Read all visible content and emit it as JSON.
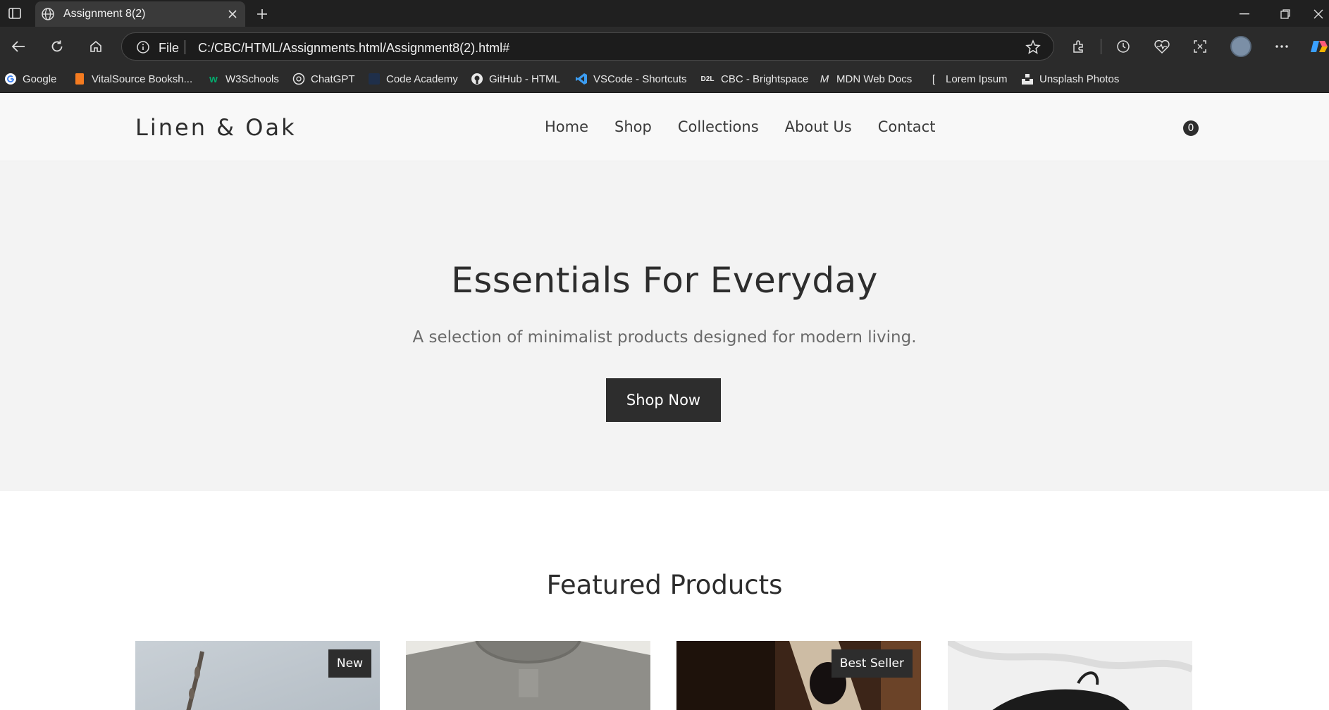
{
  "browser": {
    "tab_title": "Assignment 8(2)",
    "scheme_label": "File",
    "url": "C:/CBC/HTML/Assignments.html/Assignment8(2).html#",
    "bookmarks": [
      {
        "label": "Google",
        "icon": "google-icon",
        "color": "#ea4335"
      },
      {
        "label": "VitalSource Booksh...",
        "icon": "vitalsource-icon",
        "color": "#f47b20"
      },
      {
        "label": "W3Schools",
        "icon": "w3schools-icon",
        "color": "#04aa6d"
      },
      {
        "label": "ChatGPT",
        "icon": "chatgpt-icon",
        "color": "#e8e8e8"
      },
      {
        "label": "Code Academy",
        "icon": "codeacademy-icon",
        "color": "#1f2f4a"
      },
      {
        "label": "GitHub - HTML",
        "icon": "github-icon",
        "color": "#e8e8e8"
      },
      {
        "label": "VSCode - Shortcuts",
        "icon": "vscode-icon",
        "color": "#3c9df2"
      },
      {
        "label": "CBC - Brightspace",
        "icon": "d2l-icon",
        "color": "#e8e8e8"
      },
      {
        "label": "MDN Web Docs",
        "icon": "mdn-icon",
        "color": "#e8e8e8"
      },
      {
        "label": "Lorem Ipsum",
        "icon": "lorem-icon",
        "color": "#e8e8e8"
      },
      {
        "label": "Unsplash Photos",
        "icon": "unsplash-icon",
        "color": "#e8e8e8"
      }
    ]
  },
  "site": {
    "logo": "Linen & Oak",
    "nav": [
      "Home",
      "Shop",
      "Collections",
      "About Us",
      "Contact"
    ],
    "cart_count": "0"
  },
  "hero": {
    "title": "Essentials For Everyday",
    "subtitle": "A selection of minimalist products designed for modern living.",
    "button": "Shop Now"
  },
  "featured": {
    "title": "Featured Products",
    "products": [
      {
        "badge": "New"
      },
      {
        "badge": ""
      },
      {
        "badge": "Best Seller"
      },
      {
        "badge": ""
      }
    ]
  }
}
